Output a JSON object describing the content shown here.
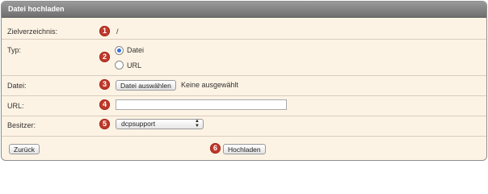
{
  "header": {
    "title": "Datei hochladen"
  },
  "form": {
    "target_dir": {
      "label": "Zielverzeichnis:",
      "value": "/",
      "marker": "1"
    },
    "type": {
      "label": "Typ:",
      "marker": "2",
      "options": [
        {
          "label": "Datei",
          "checked": true
        },
        {
          "label": "URL",
          "checked": false
        }
      ]
    },
    "file": {
      "label": "Datei:",
      "marker": "3",
      "button": "Datei auswählen",
      "status": "Keine ausgewählt"
    },
    "url": {
      "label": "URL:",
      "marker": "4",
      "value": ""
    },
    "owner": {
      "label": "Besitzer:",
      "marker": "5",
      "selected": "dcpsupport"
    }
  },
  "footer": {
    "back_label": "Zurück",
    "upload_label": "Hochladen",
    "upload_marker": "6"
  },
  "colors": {
    "badge": "#c0392b",
    "panel_bg": "#fdf3e4",
    "header_bg": "#7f7f7f"
  }
}
